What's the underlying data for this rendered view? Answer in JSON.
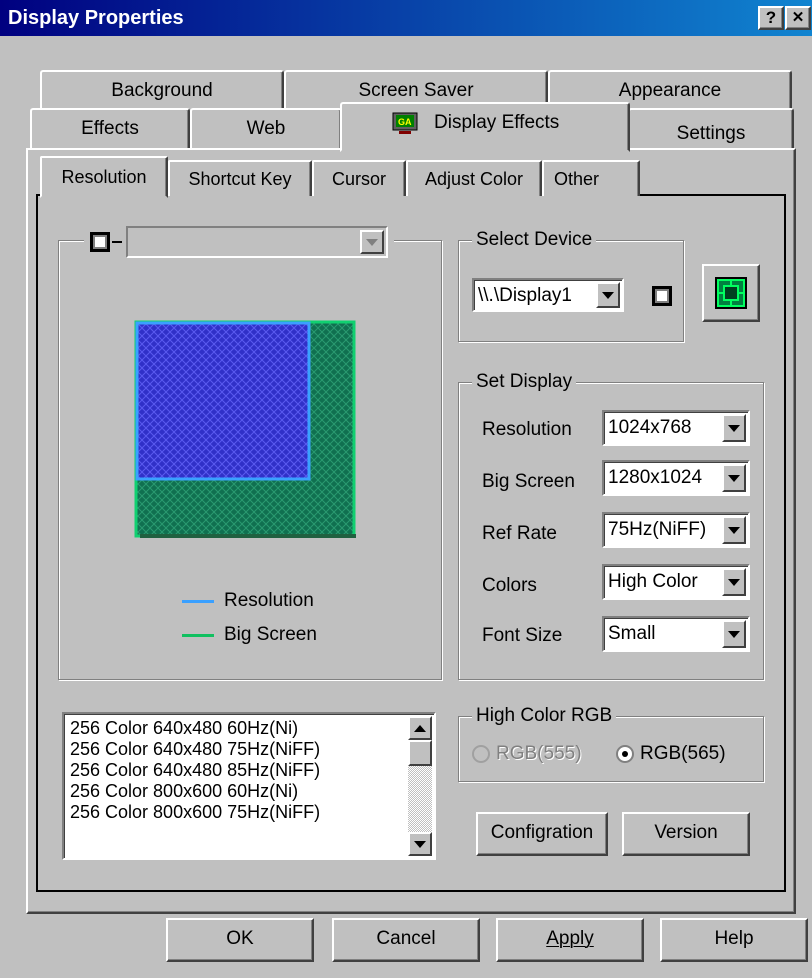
{
  "title": "Display Properties",
  "title_buttons": {
    "help": "?",
    "close": "✕"
  },
  "tabs_row1": [
    "Background",
    "Screen Saver",
    "Appearance"
  ],
  "tabs_row2": [
    "Effects",
    "Web",
    "Display Effects",
    "Settings"
  ],
  "active_tab": "Display Effects",
  "inner_tabs": [
    "Resolution",
    "Shortcut Key",
    "Cursor",
    "Adjust Color",
    "Other"
  ],
  "active_inner_tab": "Resolution",
  "preview": {
    "legend": [
      {
        "label": "Resolution",
        "color": "#3aa0ff"
      },
      {
        "label": "Big Screen",
        "color": "#10c060"
      }
    ],
    "colors": {
      "resolution_fill": "#3030c8",
      "bigscreen_fill": "#107050",
      "outline_blue": "#3aa0ff",
      "outline_green": "#10d070"
    }
  },
  "select_device": {
    "title": "Select Device",
    "value": "\\\\.\\Display1"
  },
  "set_display": {
    "title": "Set Display",
    "rows": [
      {
        "label": "Resolution",
        "value": "1024x768"
      },
      {
        "label": "Big Screen",
        "value": "1280x1024"
      },
      {
        "label": "Ref Rate",
        "value": "75Hz(NiFF)"
      },
      {
        "label": "Colors",
        "value": "High Color"
      },
      {
        "label": "Font Size",
        "value": "Small"
      }
    ]
  },
  "mode_list": [
    "256 Color 640x480 60Hz(Ni)",
    "256 Color 640x480 75Hz(NiFF)",
    "256 Color 640x480 85Hz(NiFF)",
    "256 Color 800x600 60Hz(Ni)",
    "256 Color 800x600 75Hz(NiFF)"
  ],
  "high_color_rgb": {
    "title": "High Color RGB",
    "options": [
      {
        "label": "RGB(555)",
        "selected": false,
        "enabled": false
      },
      {
        "label": "RGB(565)",
        "selected": true,
        "enabled": true
      }
    ]
  },
  "buttons": {
    "configration": "Configration",
    "version": "Version",
    "ok": "OK",
    "cancel": "Cancel",
    "apply": "Apply",
    "help": "Help"
  }
}
